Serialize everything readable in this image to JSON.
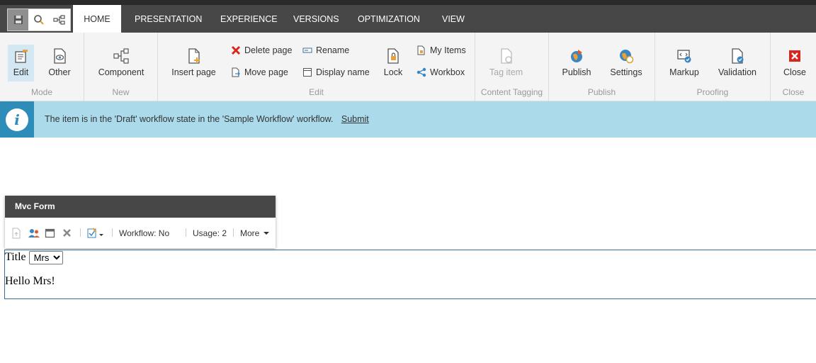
{
  "quick_access": {
    "save_icon": "save-icon",
    "search_icon": "search-icon",
    "tree_icon": "hierarchy-icon"
  },
  "tabs": [
    {
      "label": "HOME",
      "active": true
    },
    {
      "label": "PRESENTATION"
    },
    {
      "label": "EXPERIENCE"
    },
    {
      "label": "VERSIONS"
    },
    {
      "label": "OPTIMIZATION"
    },
    {
      "label": "VIEW"
    }
  ],
  "ribbon": {
    "mode": {
      "label": "Mode",
      "edit": "Edit",
      "other": "Other"
    },
    "new": {
      "label": "New",
      "component": "Component"
    },
    "edit": {
      "label": "Edit",
      "insert_page": "Insert page",
      "delete_page": "Delete page",
      "move_page": "Move page",
      "rename": "Rename",
      "display_name": "Display name",
      "lock": "Lock",
      "my_items": "My Items",
      "workbox": "Workbox"
    },
    "content_tagging": {
      "label": "Content Tagging",
      "tag_item": "Tag item"
    },
    "publish": {
      "label": "Publish",
      "publish": "Publish",
      "settings": "Settings"
    },
    "proofing": {
      "label": "Proofing",
      "markup": "Markup",
      "validation": "Validation"
    },
    "close": {
      "label": "Close",
      "close": "Close"
    }
  },
  "notification": {
    "message": "The item is in the 'Draft' workflow state in the 'Sample Workflow' workflow.",
    "link": "Submit"
  },
  "rendering_chrome": {
    "title": "Mvc Form",
    "workflow": "Workflow: No",
    "usage": "Usage: 2",
    "more": "More"
  },
  "form": {
    "title_label": "Title",
    "title_value": "Mrs",
    "greeting": "Hello Mrs!"
  },
  "colors": {
    "tabbar": "#474747",
    "info_background": "#abdbeb",
    "info_icon": "#2d8cb8",
    "selected_button": "#d3e8f3"
  }
}
